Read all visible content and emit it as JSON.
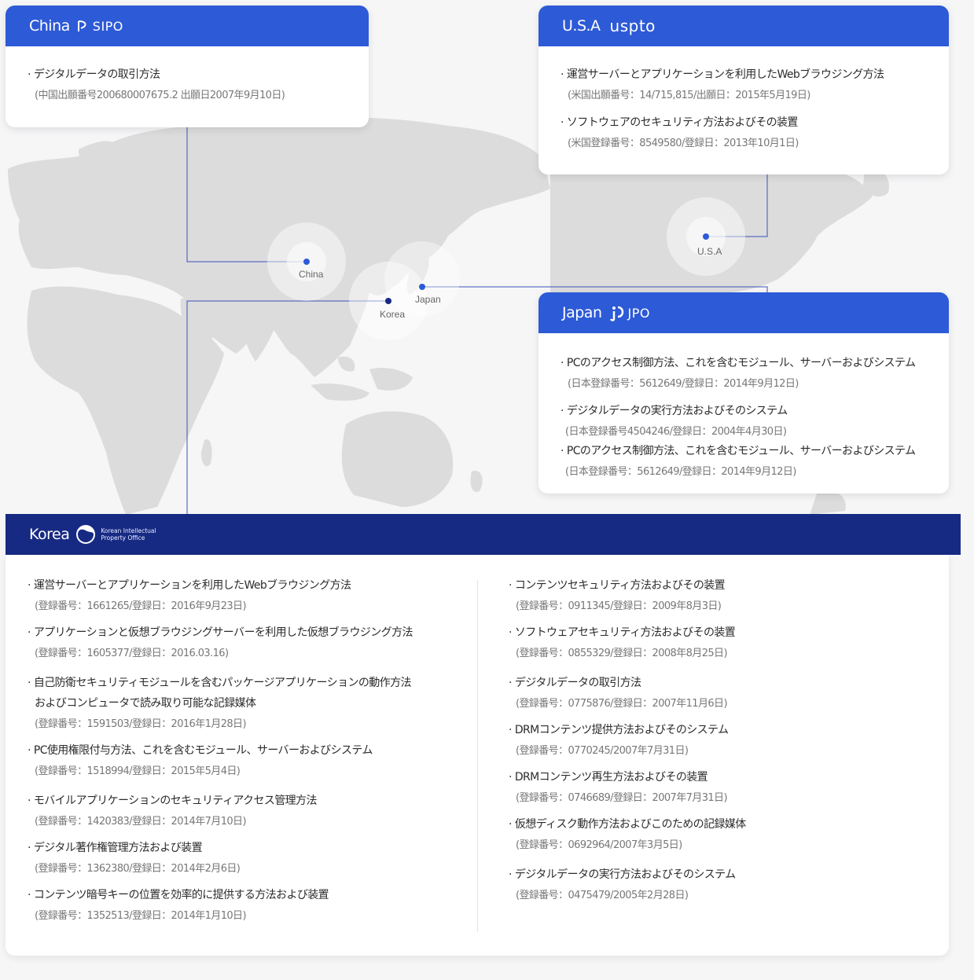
{
  "colors": {
    "accent_blue": "#2d5ad6",
    "korea_navy": "#172a83",
    "map_land": "#dcdcdd",
    "connector": "#3a52b8"
  },
  "map": {
    "markers": [
      {
        "key": "china",
        "label": "China"
      },
      {
        "key": "korea",
        "label": "Korea"
      },
      {
        "key": "japan",
        "label": "Japan"
      },
      {
        "key": "usa",
        "label": "U.S.A"
      }
    ]
  },
  "china": {
    "country": "China",
    "office": "SIPO",
    "patents": [
      {
        "title": "デジタルデータの取引方法",
        "reg": "(中国出願番号200680007675.2 出願日2007年9月10日)"
      }
    ]
  },
  "usa": {
    "country": "U.S.A",
    "office": "uspto",
    "patents": [
      {
        "title": "運営サーバーとアプリケーションを利用したWebブラウジング方法",
        "reg": "(米国出願番号：14/715,815/出願日：2015年5月19日)"
      },
      {
        "title": "ソフトウェアのセキュリティ方法およびその装置",
        "reg": "(米国登録番号：8549580/登録日：2013年10月1日)"
      }
    ]
  },
  "japan": {
    "country": "Japan",
    "office": "JPO",
    "patents": [
      {
        "title": "PCのアクセス制御方法、これを含むモジュール、サーバーおよびシステム",
        "reg": "(日本登録番号：5612649/登録日：2014年9月12日)"
      },
      {
        "title": "デジタルデータの実行方法およびそのシステム",
        "reg": "(日本登録番号4504246/登録日：2004年4月30日)"
      },
      {
        "title": "PCのアクセス制御方法、これを含むモジュール、サーバーおよびシステム",
        "reg": "(日本登録番号：5612649/登録日：2014年9月12日)"
      }
    ]
  },
  "korea": {
    "country": "Korea",
    "office_line1": "Korean Intellectual",
    "office_line2": "Property Office",
    "left": [
      {
        "title": "運営サーバーとアプリケーションを利用したWebブラウジング方法",
        "reg": "(登録番号：1661265/登録日：2016年9月23日)"
      },
      {
        "title": "アプリケーションと仮想ブラウジングサーバーを利用した仮想ブラウジング方法",
        "reg": "(登録番号：1605377/登録日：2016.03.16)"
      },
      {
        "title": "自己防衛セキュリティモジュールを含むパッケージアプリケーションの動作方法",
        "title2": "およびコンピュータで読み取り可能な記録媒体",
        "reg": "(登録番号：1591503/登録日：2016年1月28日)"
      },
      {
        "title": "PC使用権限付与方法、これを含むモジュール、サーバーおよびシステム",
        "reg": "(登録番号：1518994/登録日：2015年5月4日)"
      },
      {
        "title": "モバイルアプリケーションのセキュリティアクセス管理方法",
        "reg": "(登録番号：1420383/登録日：2014年7月10日)"
      },
      {
        "title": "デジタル著作権管理方法および装置",
        "reg": "(登録番号：1362380/登録日：2014年2月6日)"
      },
      {
        "title": "コンテンツ暗号キーの位置を効率的に提供する方法および装置",
        "reg": "(登録番号：1352513/登録日：2014年1月10日)"
      }
    ],
    "right": [
      {
        "title": "コンテンツセキュリティ方法およびその装置",
        "reg": "(登録番号：0911345/登録日：2009年8月3日)"
      },
      {
        "title": "ソフトウェアセキュリティ方法およびその装置",
        "reg": "(登録番号：0855329/登録日：2008年8月25日)"
      },
      {
        "title": "デジタルデータの取引方法",
        "reg": "(登録番号：0775876/登録日：2007年11月6日)"
      },
      {
        "title": "DRMコンテンツ提供方法およびそのシステム",
        "reg": "(登録番号：0770245/2007年7月31日)"
      },
      {
        "title": "DRMコンテンツ再生方法およびその装置",
        "reg": "(登録番号：0746689/登録日：2007年7月31日)"
      },
      {
        "title": "仮想ディスク動作方法およびこのための記録媒体",
        "reg": "(登録番号：0692964/2007年3月5日)"
      },
      {
        "title": "デジタルデータの実行方法およびそのシステム",
        "reg": "(登録番号：0475479/2005年2月28日)"
      }
    ]
  }
}
